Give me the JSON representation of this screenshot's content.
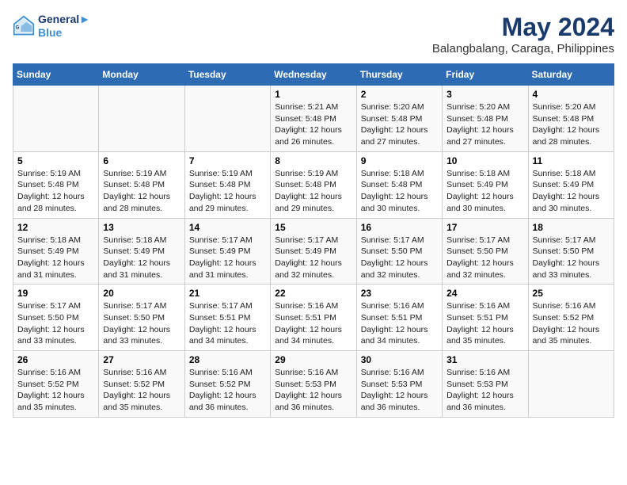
{
  "logo": {
    "line1": "General",
    "line2": "Blue"
  },
  "title": "May 2024",
  "subtitle": "Balangbalang, Caraga, Philippines",
  "days_of_week": [
    "Sunday",
    "Monday",
    "Tuesday",
    "Wednesday",
    "Thursday",
    "Friday",
    "Saturday"
  ],
  "weeks": [
    [
      {
        "day": "",
        "info": ""
      },
      {
        "day": "",
        "info": ""
      },
      {
        "day": "",
        "info": ""
      },
      {
        "day": "1",
        "info": "Sunrise: 5:21 AM\nSunset: 5:48 PM\nDaylight: 12 hours\nand 26 minutes."
      },
      {
        "day": "2",
        "info": "Sunrise: 5:20 AM\nSunset: 5:48 PM\nDaylight: 12 hours\nand 27 minutes."
      },
      {
        "day": "3",
        "info": "Sunrise: 5:20 AM\nSunset: 5:48 PM\nDaylight: 12 hours\nand 27 minutes."
      },
      {
        "day": "4",
        "info": "Sunrise: 5:20 AM\nSunset: 5:48 PM\nDaylight: 12 hours\nand 28 minutes."
      }
    ],
    [
      {
        "day": "5",
        "info": "Sunrise: 5:19 AM\nSunset: 5:48 PM\nDaylight: 12 hours\nand 28 minutes."
      },
      {
        "day": "6",
        "info": "Sunrise: 5:19 AM\nSunset: 5:48 PM\nDaylight: 12 hours\nand 28 minutes."
      },
      {
        "day": "7",
        "info": "Sunrise: 5:19 AM\nSunset: 5:48 PM\nDaylight: 12 hours\nand 29 minutes."
      },
      {
        "day": "8",
        "info": "Sunrise: 5:19 AM\nSunset: 5:48 PM\nDaylight: 12 hours\nand 29 minutes."
      },
      {
        "day": "9",
        "info": "Sunrise: 5:18 AM\nSunset: 5:48 PM\nDaylight: 12 hours\nand 30 minutes."
      },
      {
        "day": "10",
        "info": "Sunrise: 5:18 AM\nSunset: 5:49 PM\nDaylight: 12 hours\nand 30 minutes."
      },
      {
        "day": "11",
        "info": "Sunrise: 5:18 AM\nSunset: 5:49 PM\nDaylight: 12 hours\nand 30 minutes."
      }
    ],
    [
      {
        "day": "12",
        "info": "Sunrise: 5:18 AM\nSunset: 5:49 PM\nDaylight: 12 hours\nand 31 minutes."
      },
      {
        "day": "13",
        "info": "Sunrise: 5:18 AM\nSunset: 5:49 PM\nDaylight: 12 hours\nand 31 minutes."
      },
      {
        "day": "14",
        "info": "Sunrise: 5:17 AM\nSunset: 5:49 PM\nDaylight: 12 hours\nand 31 minutes."
      },
      {
        "day": "15",
        "info": "Sunrise: 5:17 AM\nSunset: 5:49 PM\nDaylight: 12 hours\nand 32 minutes."
      },
      {
        "day": "16",
        "info": "Sunrise: 5:17 AM\nSunset: 5:50 PM\nDaylight: 12 hours\nand 32 minutes."
      },
      {
        "day": "17",
        "info": "Sunrise: 5:17 AM\nSunset: 5:50 PM\nDaylight: 12 hours\nand 32 minutes."
      },
      {
        "day": "18",
        "info": "Sunrise: 5:17 AM\nSunset: 5:50 PM\nDaylight: 12 hours\nand 33 minutes."
      }
    ],
    [
      {
        "day": "19",
        "info": "Sunrise: 5:17 AM\nSunset: 5:50 PM\nDaylight: 12 hours\nand 33 minutes."
      },
      {
        "day": "20",
        "info": "Sunrise: 5:17 AM\nSunset: 5:50 PM\nDaylight: 12 hours\nand 33 minutes."
      },
      {
        "day": "21",
        "info": "Sunrise: 5:17 AM\nSunset: 5:51 PM\nDaylight: 12 hours\nand 34 minutes."
      },
      {
        "day": "22",
        "info": "Sunrise: 5:16 AM\nSunset: 5:51 PM\nDaylight: 12 hours\nand 34 minutes."
      },
      {
        "day": "23",
        "info": "Sunrise: 5:16 AM\nSunset: 5:51 PM\nDaylight: 12 hours\nand 34 minutes."
      },
      {
        "day": "24",
        "info": "Sunrise: 5:16 AM\nSunset: 5:51 PM\nDaylight: 12 hours\nand 35 minutes."
      },
      {
        "day": "25",
        "info": "Sunrise: 5:16 AM\nSunset: 5:52 PM\nDaylight: 12 hours\nand 35 minutes."
      }
    ],
    [
      {
        "day": "26",
        "info": "Sunrise: 5:16 AM\nSunset: 5:52 PM\nDaylight: 12 hours\nand 35 minutes."
      },
      {
        "day": "27",
        "info": "Sunrise: 5:16 AM\nSunset: 5:52 PM\nDaylight: 12 hours\nand 35 minutes."
      },
      {
        "day": "28",
        "info": "Sunrise: 5:16 AM\nSunset: 5:52 PM\nDaylight: 12 hours\nand 36 minutes."
      },
      {
        "day": "29",
        "info": "Sunrise: 5:16 AM\nSunset: 5:53 PM\nDaylight: 12 hours\nand 36 minutes."
      },
      {
        "day": "30",
        "info": "Sunrise: 5:16 AM\nSunset: 5:53 PM\nDaylight: 12 hours\nand 36 minutes."
      },
      {
        "day": "31",
        "info": "Sunrise: 5:16 AM\nSunset: 5:53 PM\nDaylight: 12 hours\nand 36 minutes."
      },
      {
        "day": "",
        "info": ""
      }
    ]
  ]
}
